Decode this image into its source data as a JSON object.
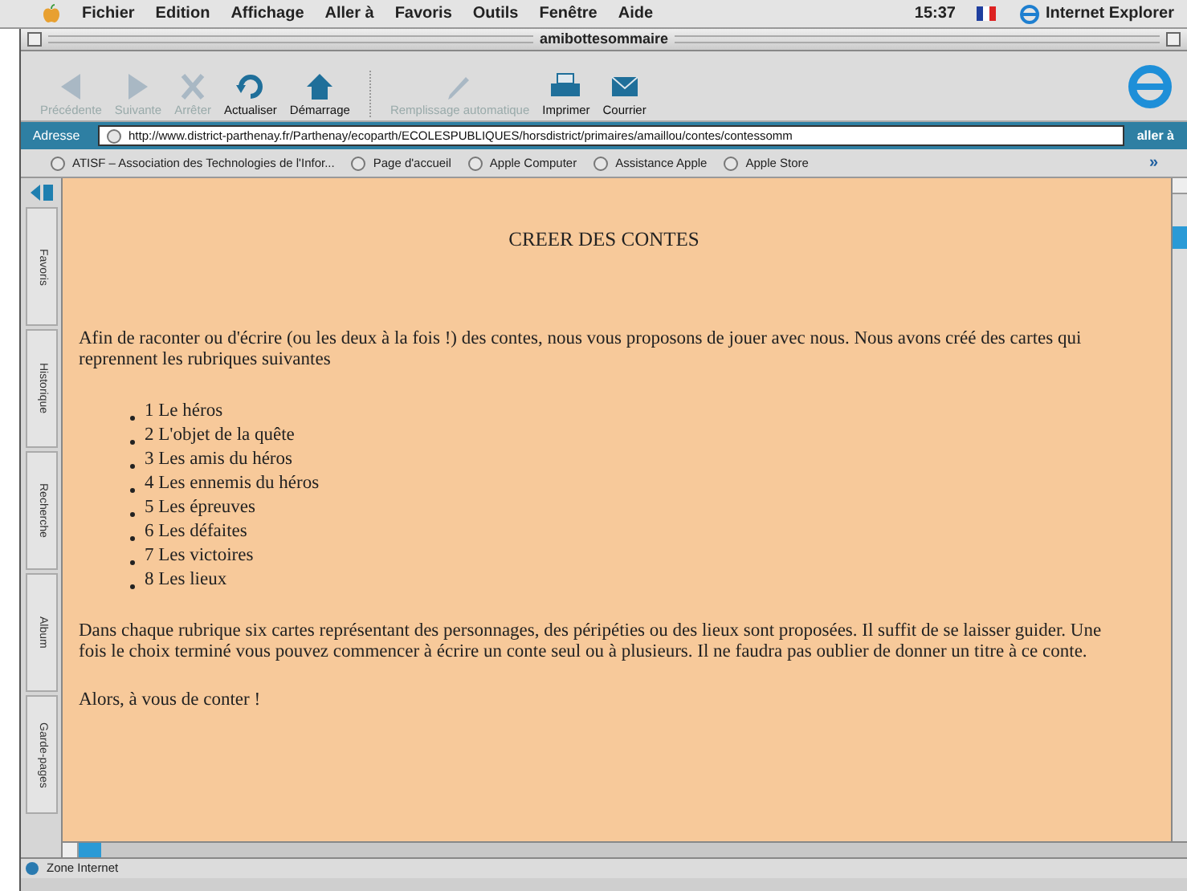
{
  "menu_bar": {
    "items": [
      "Fichier",
      "Edition",
      "Affichage",
      "Aller à",
      "Favoris",
      "Outils",
      "Fenêtre",
      "Aide"
    ],
    "clock": "15:37",
    "app": "Internet Explorer"
  },
  "window": {
    "title": "amibottesommaire"
  },
  "toolbar": [
    {
      "label": "Précédente",
      "disabled": true
    },
    {
      "label": "Suivante",
      "disabled": true
    },
    {
      "label": "Arrêter",
      "disabled": true
    },
    {
      "label": "Actualiser",
      "disabled": false
    },
    {
      "label": "Démarrage",
      "disabled": false
    },
    {
      "label": "Remplissage automatique",
      "disabled": true
    },
    {
      "label": "Imprimer",
      "disabled": false
    },
    {
      "label": "Courrier",
      "disabled": false
    }
  ],
  "address_bar": {
    "label": "Adresse",
    "value": "http://www.district-parthenay.fr/Parthenay/ecoparth/ECOLESPUBLIQUES/horsdistrict/primaires/amaillou/contes/contessomm",
    "go": "aller à"
  },
  "favorites_bar": {
    "items": [
      "ATISF – Association des Technologies de l'Infor...",
      "Page d'accueil",
      "Apple Computer",
      "Assistance Apple",
      "Apple Store"
    ],
    "more": "»"
  },
  "side_tabs": [
    "Favoris",
    "Historique",
    "Recherche",
    "Album",
    "Garde-pages"
  ],
  "page": {
    "title": "CREER DES CONTES",
    "intro": "Afin de raconter ou d'écrire (ou les deux à la fois !) des contes, nous vous proposons de jouer avec nous. Nous avons créé des cartes qui reprennent les rubriques suivantes",
    "list": [
      "1 Le héros",
      "2 L'objet de la quête",
      "3 Les amis du héros",
      "4 Les ennemis du héros",
      "5 Les épreuves",
      "6 Les défaites",
      "7 Les victoires",
      "8 Les lieux"
    ],
    "paragraph": "Dans chaque rubrique six cartes représentant des personnages, des péripéties ou des lieux sont proposées. Il suffit de se laisser guider. Une fois le choix terminé vous pouvez commencer à écrire un conte seul ou à plusieurs. Il ne faudra pas oublier de donner un titre à ce conte.",
    "closing": "Alors, à vous de conter !"
  },
  "status_bar": {
    "text": "Zone Internet"
  }
}
